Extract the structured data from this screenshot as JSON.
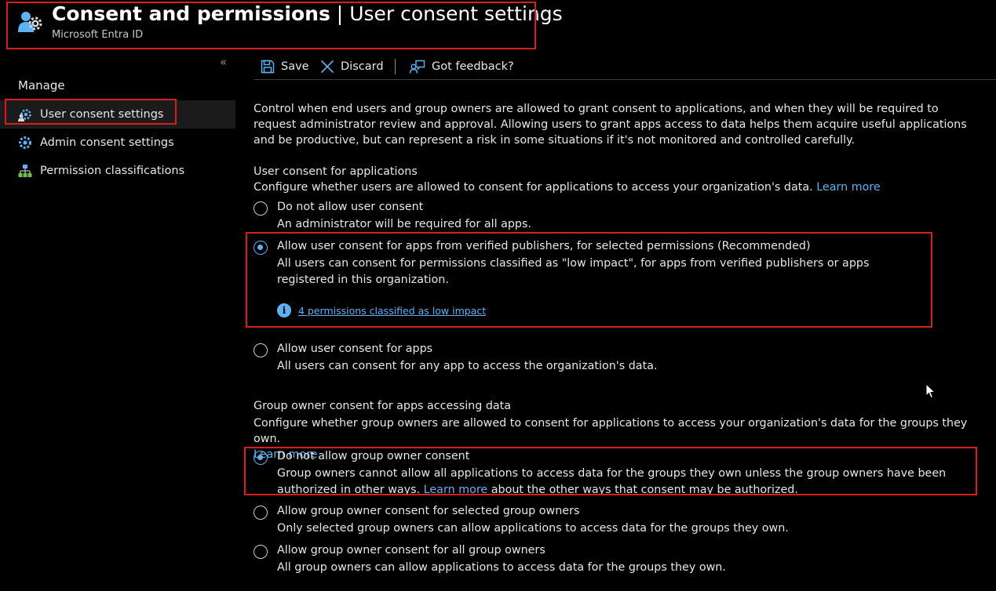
{
  "header": {
    "title_bold": "Consent and permissions",
    "separator": " | ",
    "title_light": "User consent settings",
    "subtitle": "Microsoft Entra ID",
    "more": "..."
  },
  "sidebar": {
    "collapse_glyph": "«",
    "section_label": "Manage",
    "items": [
      {
        "label": "User consent settings",
        "icon": "gear-user-icon",
        "selected": true
      },
      {
        "label": "Admin consent settings",
        "icon": "gear-icon",
        "selected": false
      },
      {
        "label": "Permission classifications",
        "icon": "hierarchy-icon",
        "selected": false
      }
    ]
  },
  "toolbar": {
    "save_label": "Save",
    "discard_label": "Discard",
    "feedback_label": "Got feedback?"
  },
  "intro": "Control when end users and group owners are allowed to grant consent to applications, and when they will be required to request administrator review and approval. Allowing users to grant apps access to data helps them acquire useful applications and be productive, but can represent a risk in some situations if it's not monitored and controlled carefully.",
  "user_consent": {
    "title": "User consent for applications",
    "description": "Configure whether users are allowed to consent for applications to access your organization's data.",
    "learn_more": "Learn more",
    "options": [
      {
        "label": "Do not allow user consent",
        "description": "An administrator will be required for all apps.",
        "selected": false
      },
      {
        "label": "Allow user consent for apps from verified publishers, for selected permissions (Recommended)",
        "description": "All users can consent for permissions classified as \"low impact\", for apps from verified publishers or apps registered in this organization.",
        "selected": true,
        "info_link": "4 permissions classified as low impact"
      },
      {
        "label": "Allow user consent for apps",
        "description": "All users can consent for any app to access the organization's data.",
        "selected": false
      }
    ]
  },
  "group_consent": {
    "title": "Group owner consent for apps accessing data",
    "description": "Configure whether group owners are allowed to consent for applications to access your organization's data for the groups they own.",
    "learn_more": "Learn more",
    "options": [
      {
        "label": "Do not allow group owner consent",
        "description_before": "Group owners cannot allow all applications to access data for the groups they own unless the group owners have been authorized in other ways.",
        "description_link": "Learn more",
        "description_after": "about the other ways that consent may be authorized.",
        "selected": true
      },
      {
        "label": "Allow group owner consent for selected group owners",
        "description": "Only selected group owners can allow applications to access data for the groups they own.",
        "selected": false
      },
      {
        "label": "Allow group owner consent for all group owners",
        "description": "All group owners can allow applications to access data for the groups they own.",
        "selected": false
      }
    ]
  },
  "colors": {
    "accent": "#5fb2f2",
    "highlight_box": "#d91d1d",
    "background": "#000000"
  }
}
